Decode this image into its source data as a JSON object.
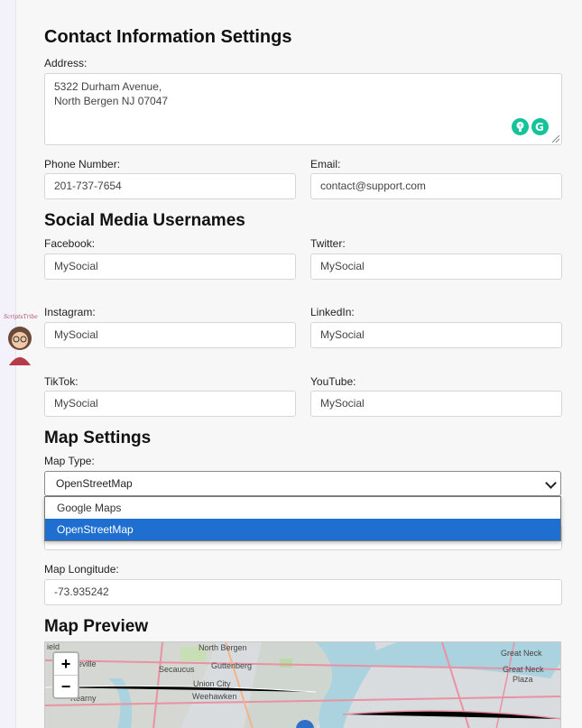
{
  "contact": {
    "title": "Contact Information Settings",
    "address_label": "Address:",
    "address_line1": "5322 Durham Avenue,",
    "address_line2": "North Bergen NJ 07047",
    "phone_label": "Phone Number:",
    "phone_value": "201-737-7654",
    "email_label": "Email:",
    "email_value": "contact@support.com"
  },
  "social": {
    "title": "Social Media Usernames",
    "fields": [
      {
        "label": "Facebook:",
        "value": "MySocial"
      },
      {
        "label": "Twitter:",
        "value": "MySocial"
      },
      {
        "label": "Instagram:",
        "value": "MySocial"
      },
      {
        "label": "LinkedIn:",
        "value": "MySocial"
      },
      {
        "label": "TikTok:",
        "value": "MySocial"
      },
      {
        "label": "YouTube:",
        "value": "MySocial"
      }
    ]
  },
  "map_settings": {
    "title": "Map Settings",
    "type_label": "Map Type:",
    "type_selected": "OpenStreetMap",
    "options": [
      "Google Maps",
      "OpenStreetMap"
    ],
    "longitude_label": "Map Longitude:",
    "longitude_value": "-73.935242"
  },
  "preview": {
    "title": "Map Preview",
    "zoom_in": "+",
    "zoom_out": "−",
    "places": [
      "ield",
      "North Bergen",
      "Great Neck",
      "eville",
      "Secaucus",
      "Guttenberg",
      "Great Neck",
      "Plaza",
      "Union City",
      "Kearny",
      "Weehawken"
    ]
  },
  "avatar": {
    "caption": "ScriptsTribe"
  },
  "colors": {
    "accent": "#1f6fd0",
    "panel": "#f7f7f8",
    "grammarly": "#15c39a"
  }
}
